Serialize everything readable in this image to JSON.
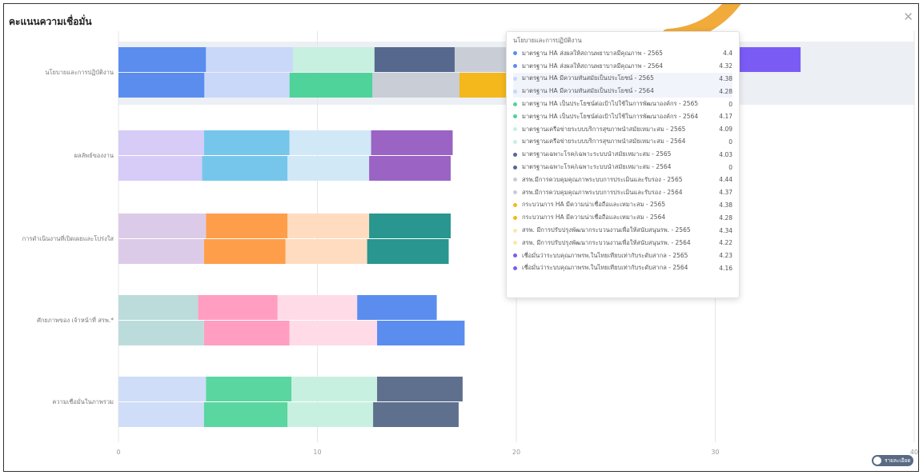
{
  "title": "คะแนนความเชื่อมั่น",
  "close_icon": "close-icon",
  "toggle_label": "รายละเอียด",
  "chart_data": {
    "type": "bar",
    "orientation": "horizontal-stacked",
    "xlim": [
      0,
      40
    ],
    "xticks": [
      "0",
      "10",
      "20",
      "30",
      "40"
    ],
    "grid": true,
    "categories": [
      "นโยบายและการปฏิบัติงาน",
      "ผลลัพธ์ของงาน",
      "การดำเนินงานที่เปิดเผยและโปร่งใส",
      "ศักยภาพของ เจ้าหน้าที่ สรพ.*",
      "ความเชื่อมั่นในภาพรวม"
    ],
    "series": [
      {
        "name": "มาตรฐาน HA ส่งผลให้สถานพยาบาลมีคุณภาพ - 2565",
        "color": "#5b8def",
        "values": [
          4.4,
          null,
          null,
          null,
          null
        ]
      },
      {
        "name": "มาตรฐาน HA ส่งผลให้สถานพยาบาลมีคุณภาพ - 2564",
        "color": "#5b8def",
        "values": [
          4.32,
          null,
          null,
          null,
          null
        ]
      },
      {
        "name": "มาตรฐาน HA มีความทันสมัยเป็นประโยชน์ - 2565",
        "color": "#c9d8f8",
        "values": [
          4.38,
          null,
          null,
          null,
          null
        ]
      },
      {
        "name": "มาตรฐาน HA มีความทันสมัยเป็นประโยชน์ - 2564",
        "color": "#c9d8f8",
        "values": [
          4.28,
          null,
          null,
          null,
          null
        ]
      },
      {
        "name": "มาตรฐาน HA เป็นประโยชน์ต่อเป้าไปใช้ในการพัฒนาองค์กร - 2565",
        "color": "#4fd39a",
        "values": [
          0,
          null,
          null,
          null,
          null
        ]
      },
      {
        "name": "มาตรฐาน HA เป็นประโยชน์ต่อเป้าไปใช้ในการพัฒนาองค์กร - 2564",
        "color": "#4fd39a",
        "values": [
          4.17,
          null,
          null,
          null,
          null
        ]
      },
      {
        "name": "มาตรฐานเครือข่ายระบบบริการสุขภาพนำสมัยเหมาะสม - 2565",
        "color": "#c8f0e0",
        "values": [
          4.09,
          null,
          null,
          null,
          null
        ]
      },
      {
        "name": "มาตรฐานเครือข่ายระบบบริการสุขภาพนำสมัยเหมาะสม - 2564",
        "color": "#c8f0e0",
        "values": [
          0,
          null,
          null,
          null,
          null
        ]
      },
      {
        "name": "มาตรฐานเฉพาะโรค/เฉพาะระบบนำสมัยเหมาะสม - 2565",
        "color": "#56688e",
        "values": [
          4.03,
          null,
          null,
          null,
          null
        ]
      },
      {
        "name": "มาตรฐานเฉพาะโรค/เฉพาะระบบนำสมัยเหมาะสม - 2564",
        "color": "#56688e",
        "values": [
          0,
          null,
          null,
          null,
          null
        ]
      },
      {
        "name": "สรพ.มีการควบคุมคุณภาพระบบการประเมินและรับรอง - 2565",
        "color": "#c9cdd6",
        "values": [
          4.44,
          null,
          null,
          null,
          null
        ]
      },
      {
        "name": "สรพ.มีการควบคุมคุณภาพระบบการประเมินและรับรอง - 2564",
        "color": "#c9cdd6",
        "values": [
          4.37,
          null,
          null,
          null,
          null
        ]
      },
      {
        "name": "กระบวนการ HA มีความน่าเชื่อถือและเหมาะสม - 2565",
        "color": "#f5b81c",
        "values": [
          4.38,
          null,
          null,
          null,
          null
        ]
      },
      {
        "name": "กระบวนการ HA มีความน่าเชื่อถือและเหมาะสม - 2564",
        "color": "#f5b81c",
        "values": [
          4.28,
          null,
          null,
          null,
          null
        ]
      },
      {
        "name": "สรพ. มีการปรับปรุงพัฒนากระบวนงานเพื่อให้สนับสนุนรพ. - 2565",
        "color": "#fbe7b0",
        "values": [
          4.34,
          null,
          null,
          null,
          null
        ]
      },
      {
        "name": "สรพ. มีการปรับปรุงพัฒนากระบวนงานเพื่อให้สนับสนุนรพ. - 2564",
        "color": "#fbe7b0",
        "values": [
          4.22,
          null,
          null,
          null,
          null
        ]
      },
      {
        "name": "เชื่อมั่นว่าระบบคุณภาพรพ.ในไทยเทียบเท่ากับระดับสากล - 2565",
        "color": "#7a5cf4",
        "values": [
          4.23,
          null,
          null,
          null,
          null
        ]
      },
      {
        "name": "เชื่อมั่นว่าระบบคุณภาพรพ.ในไทยเทียบเท่ากับระดับสากล - 2564",
        "color": "#7a5cf4",
        "values": [
          4.16,
          null,
          null,
          null,
          null
        ]
      }
    ],
    "visible_rows": [
      [
        [
          [
            4.4,
            "#5b8def"
          ],
          [
            4.38,
            "#c9d8f8"
          ],
          [
            4.09,
            "#c8f0e0"
          ],
          [
            4.03,
            "#56688e"
          ],
          [
            4.44,
            "#c9cdd6"
          ],
          [
            4.38,
            "#f5b81c"
          ],
          [
            4.34,
            "#fbe7b0"
          ],
          [
            4.23,
            "#7a5cf4"
          ]
        ],
        [
          [
            4.32,
            "#5b8def"
          ],
          [
            4.28,
            "#c9d8f8"
          ],
          [
            4.17,
            "#4fd39a"
          ],
          [
            4.37,
            "#c9cdd6"
          ],
          [
            4.28,
            "#f5b81c"
          ]
        ]
      ],
      [
        [
          [
            4.3,
            "#d6ccf7"
          ],
          [
            4.3,
            "#76c6ec"
          ],
          [
            4.1,
            "#d1e8f7"
          ],
          [
            4.1,
            "#9a63c4"
          ]
        ],
        [
          [
            4.2,
            "#d6ccf7"
          ],
          [
            4.3,
            "#76c6ec"
          ],
          [
            4.1,
            "#d1e8f7"
          ],
          [
            4.1,
            "#9a63c4"
          ]
        ]
      ],
      [
        [
          [
            4.4,
            "#dccbe8"
          ],
          [
            4.1,
            "#ff9e4a"
          ],
          [
            4.1,
            "#ffdcc0"
          ],
          [
            4.1,
            "#29968f"
          ]
        ],
        [
          [
            4.3,
            "#dccbe8"
          ],
          [
            4.1,
            "#ff9e4a"
          ],
          [
            4.1,
            "#ffdcc0"
          ],
          [
            4.1,
            "#29968f"
          ]
        ]
      ],
      [
        [
          [
            4.0,
            "#bcdcdb"
          ],
          [
            4.0,
            "#ff9ec1"
          ],
          [
            4.0,
            "#ffdbe8"
          ],
          [
            4.0,
            "#5b8def"
          ]
        ],
        [
          [
            4.3,
            "#bcdcdb"
          ],
          [
            4.3,
            "#ff9ec1"
          ],
          [
            4.4,
            "#ffdbe8"
          ],
          [
            4.4,
            "#5b8def"
          ]
        ]
      ],
      [
        [
          [
            4.4,
            "#cfddf8"
          ],
          [
            4.3,
            "#5ad6a0"
          ],
          [
            4.3,
            "#c8f0e0"
          ],
          [
            4.3,
            "#5f6f8e"
          ]
        ],
        [
          [
            4.3,
            "#cfddf8"
          ],
          [
            4.2,
            "#5ad6a0"
          ],
          [
            4.3,
            "#c8f0e0"
          ],
          [
            4.3,
            "#5f6f8e"
          ]
        ]
      ]
    ]
  },
  "tooltip": {
    "title": "นโยบายและการปฏิบัติงาน",
    "rows": [
      {
        "label": "มาตรฐาน HA ส่งผลให้สถานพยาบาลมีคุณภาพ - 2565",
        "value": "4.4",
        "color": "#5b8def"
      },
      {
        "label": "มาตรฐาน HA ส่งผลให้สถานพยาบาลมีคุณภาพ - 2564",
        "value": "4.32",
        "color": "#5b8def"
      },
      {
        "label": "มาตรฐาน HA มีความทันสมัยเป็นประโยชน์ - 2565",
        "value": "4.38",
        "color": "#c9d8f8"
      },
      {
        "label": "มาตรฐาน HA มีความทันสมัยเป็นประโยชน์ - 2564",
        "value": "4.28",
        "color": "#c9d8f8"
      },
      {
        "label": "มาตรฐาน HA เป็นประโยชน์ต่อเป้าไปใช้ในการพัฒนาองค์กร - 2565",
        "value": "0",
        "color": "#4fd39a"
      },
      {
        "label": "มาตรฐาน HA เป็นประโยชน์ต่อเป้าไปใช้ในการพัฒนาองค์กร - 2564",
        "value": "4.17",
        "color": "#4fd39a"
      },
      {
        "label": "มาตรฐานเครือข่ายระบบบริการสุขภาพนำสมัยเหมาะสม - 2565",
        "value": "4.09",
        "color": "#c8f0e0"
      },
      {
        "label": "มาตรฐานเครือข่ายระบบบริการสุขภาพนำสมัยเหมาะสม - 2564",
        "value": "0",
        "color": "#c8f0e0"
      },
      {
        "label": "มาตรฐานเฉพาะโรค/เฉพาะระบบนำสมัยเหมาะสม - 2565",
        "value": "4.03",
        "color": "#56688e"
      },
      {
        "label": "มาตรฐานเฉพาะโรค/เฉพาะระบบนำสมัยเหมาะสม - 2564",
        "value": "0",
        "color": "#56688e"
      },
      {
        "label": "สรพ.มีการควบคุมคุณภาพระบบการประเมินและรับรอง - 2565",
        "value": "4.44",
        "color": "#c9cdd6"
      },
      {
        "label": "สรพ.มีการควบคุมคุณภาพระบบการประเมินและรับรอง - 2564",
        "value": "4.37",
        "color": "#c9cdd6"
      },
      {
        "label": "กระบวนการ HA มีความน่าเชื่อถือและเหมาะสม - 2565",
        "value": "4.38",
        "color": "#f5b81c"
      },
      {
        "label": "กระบวนการ HA มีความน่าเชื่อถือและเหมาะสม - 2564",
        "value": "4.28",
        "color": "#f5b81c"
      },
      {
        "label": "สรพ. มีการปรับปรุงพัฒนากระบวนงานเพื่อให้สนับสนุนรพ. - 2565",
        "value": "4.34",
        "color": "#fbe7b0"
      },
      {
        "label": "สรพ. มีการปรับปรุงพัฒนากระบวนงานเพื่อให้สนับสนุนรพ. - 2564",
        "value": "4.22",
        "color": "#fbe7b0"
      },
      {
        "label": "เชื่อมั่นว่าระบบคุณภาพรพ.ในไทยเทียบเท่ากับระดับสากล - 2565",
        "value": "4.23",
        "color": "#7a5cf4"
      },
      {
        "label": "เชื่อมั่นว่าระบบคุณภาพรพ.ในไทยเทียบเท่ากับระดับสากล - 2564",
        "value": "4.16",
        "color": "#7a5cf4"
      }
    ]
  }
}
